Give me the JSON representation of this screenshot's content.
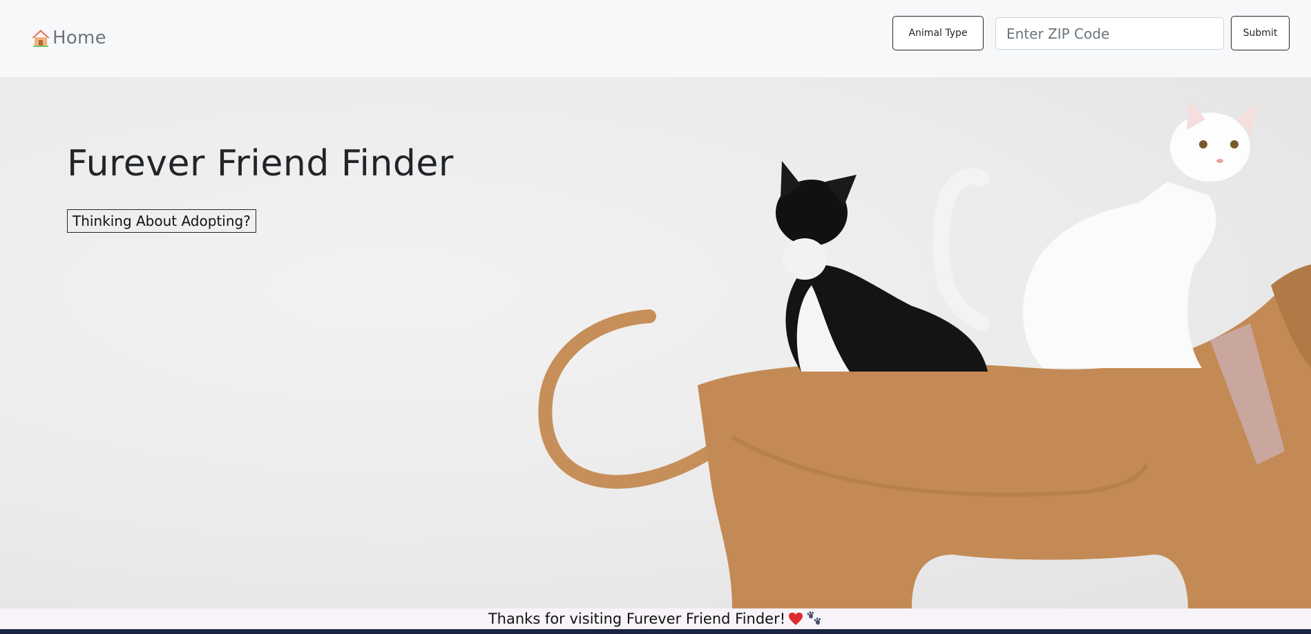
{
  "nav": {
    "brand_label": "Home",
    "animal_type_label": "Animal Type",
    "zip_placeholder": "Enter ZIP Code",
    "zip_value": "",
    "submit_label": "Submit"
  },
  "hero": {
    "title": "Furever Friend Finder",
    "cta_label": "Thinking About Adopting?",
    "image_subject": "black-and-white cat and white cat sitting on a tan dog"
  },
  "footer": {
    "message": "Thanks for visiting Furever Friend Finder!",
    "icons": [
      "red-heart-icon",
      "paw-prints-icon"
    ]
  },
  "colors": {
    "nav_background": "#f7f8fa",
    "text_dark": "#212529",
    "footer_background": "#f7f3f8",
    "bottom_bar": "#1b2440"
  }
}
